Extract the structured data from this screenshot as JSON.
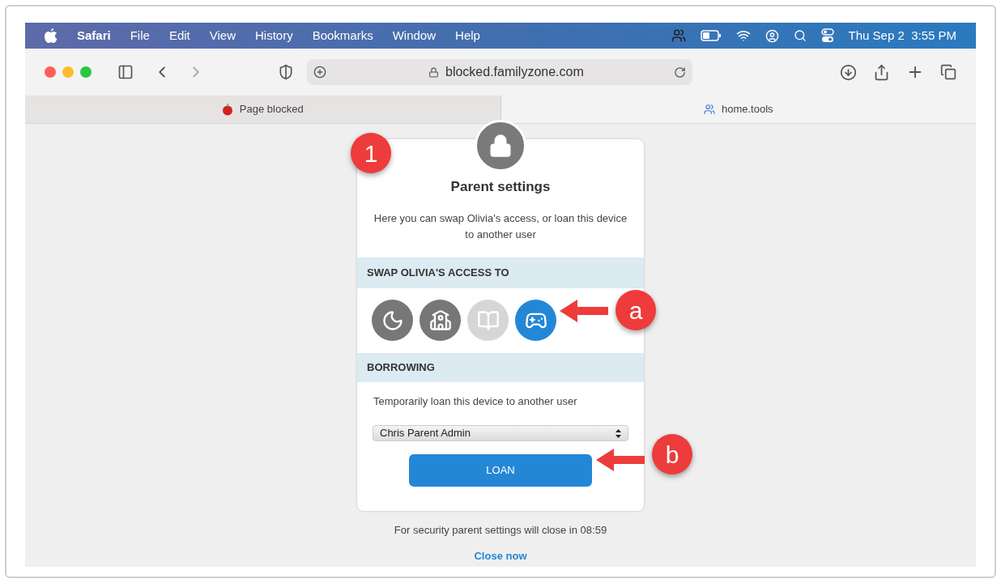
{
  "menu_bar": {
    "app": "Safari",
    "items": [
      "File",
      "Edit",
      "View",
      "History",
      "Bookmarks",
      "Window",
      "Help"
    ],
    "clock": "Thu Sep 2  3:55 PM"
  },
  "address_bar": {
    "url": "blocked.familyzone.com"
  },
  "tabs": [
    {
      "label": "Page blocked",
      "selected": true
    },
    {
      "label": "home.tools",
      "selected": false
    }
  ],
  "card": {
    "title": "Parent settings",
    "description": "Here you can swap Olivia's access, or loan this device to another user",
    "swap_heading": "SWAP OLIVIA'S ACCESS TO",
    "modes": [
      {
        "kind": "bedtime",
        "selected": false,
        "disabled": false
      },
      {
        "kind": "school",
        "selected": false,
        "disabled": false
      },
      {
        "kind": "study",
        "selected": false,
        "disabled": true
      },
      {
        "kind": "play",
        "selected": true,
        "disabled": false
      }
    ],
    "borrow_heading": "BORROWING",
    "borrow_text": "Temporarily loan this device to another user",
    "user_select": {
      "value": "Chris Parent Admin"
    },
    "loan_button": "LOAN"
  },
  "footer": {
    "notice": "For security parent settings will close in 08:59",
    "close_link": "Close now"
  },
  "annotations": [
    {
      "label": "1"
    },
    {
      "label": "a"
    },
    {
      "label": "b"
    }
  ]
}
